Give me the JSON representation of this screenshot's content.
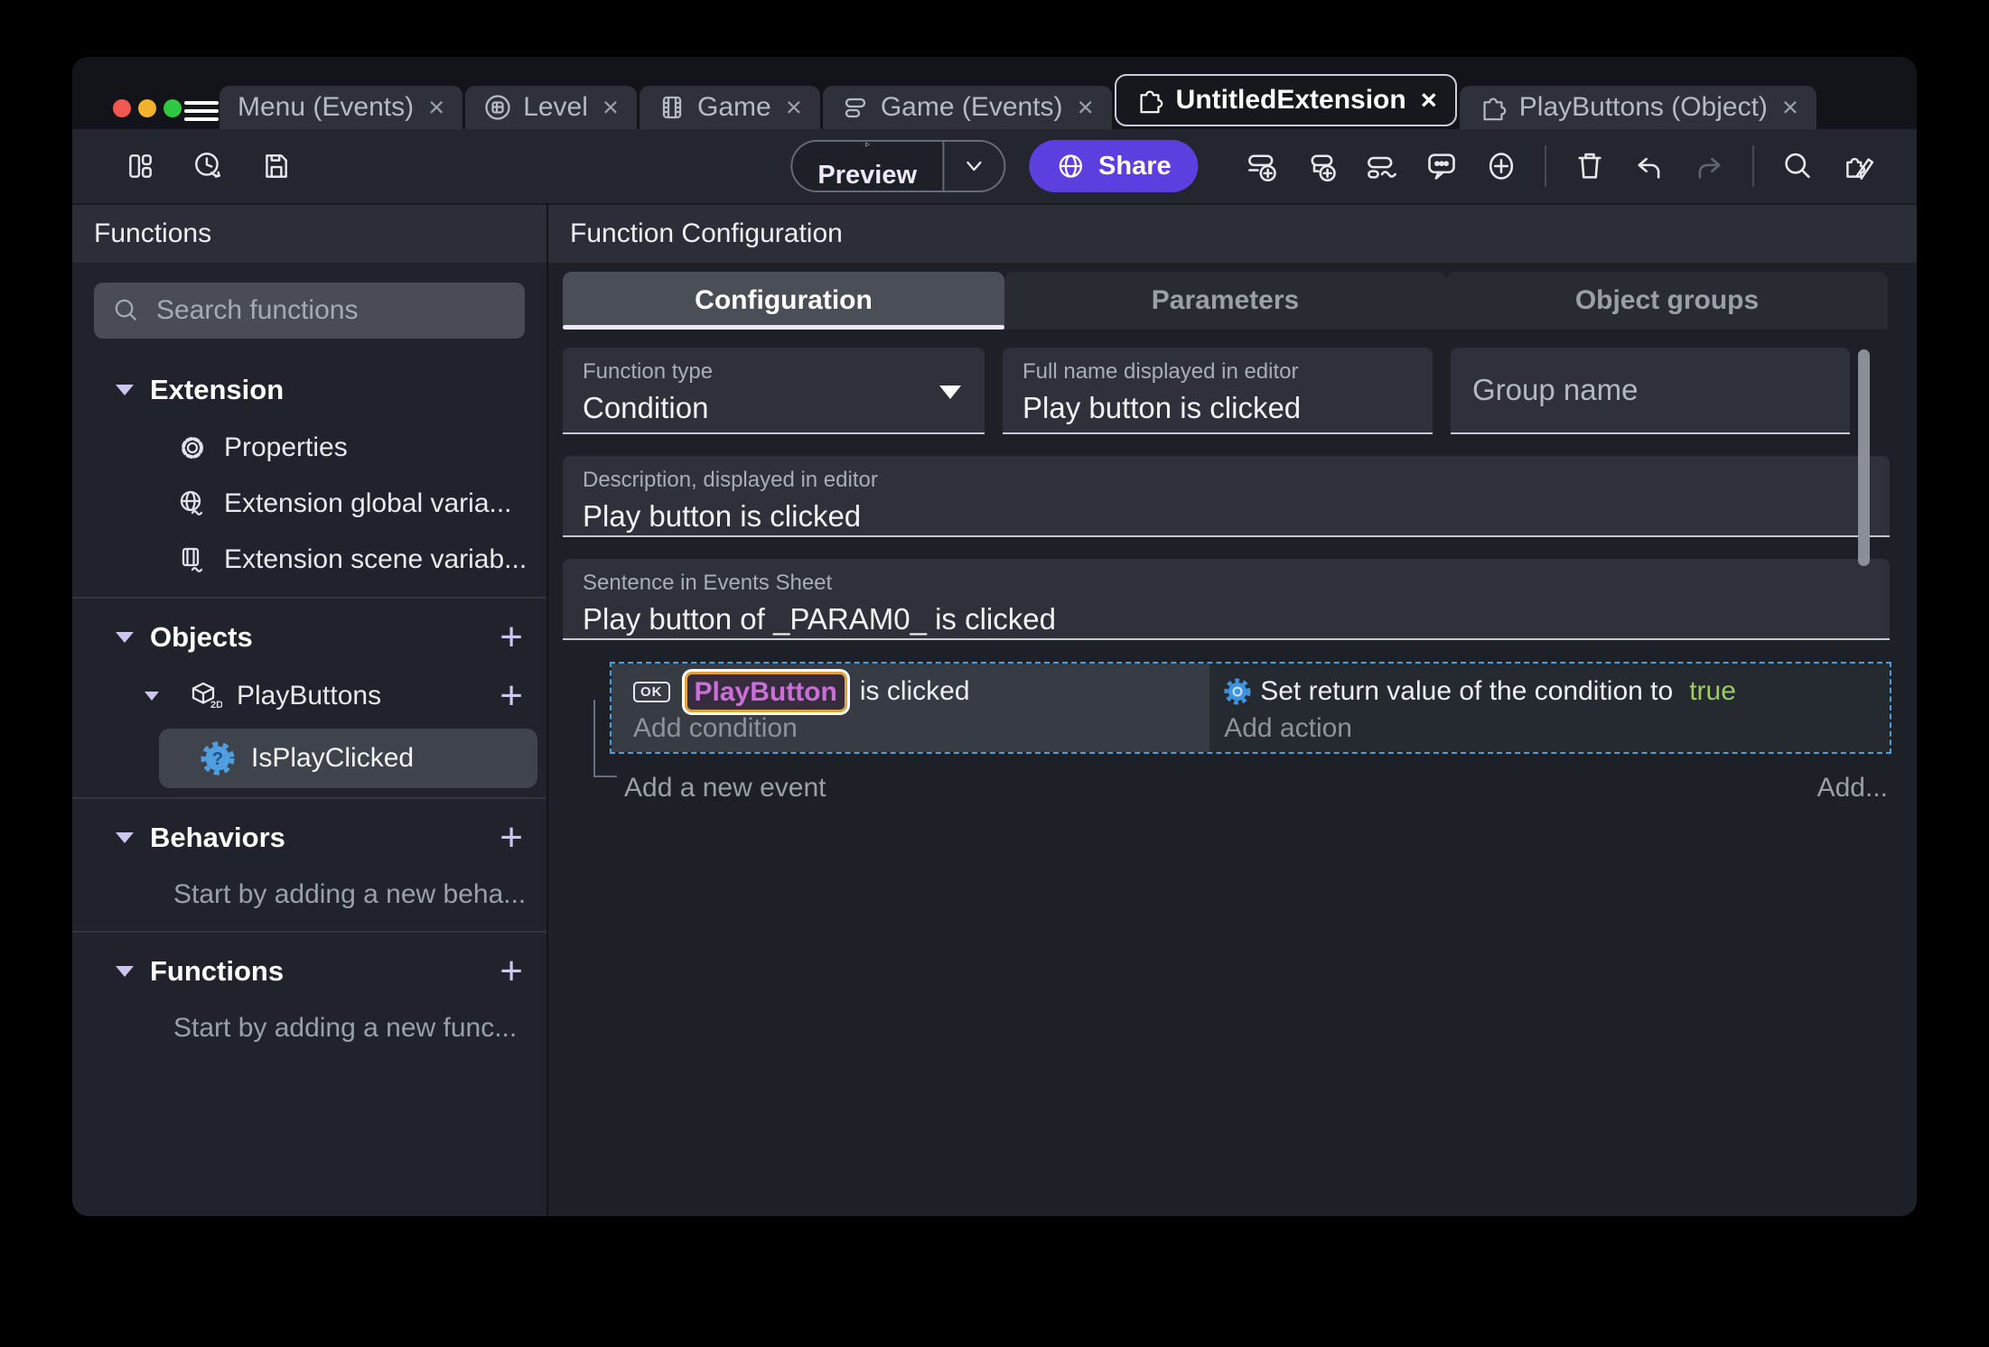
{
  "tabs": [
    {
      "label": "Menu (Events)"
    },
    {
      "label": "Level"
    },
    {
      "label": "Game"
    },
    {
      "label": "Game (Events)"
    },
    {
      "label": "UntitledExtension"
    },
    {
      "label": "PlayButtons (Object)"
    }
  ],
  "tab_close_glyph": "×",
  "toolbar": {
    "preview_label": "Preview",
    "share_label": "Share"
  },
  "sidebar": {
    "title": "Functions",
    "search_placeholder": "Search functions",
    "plus_glyph": "+",
    "extension_label": "Extension",
    "properties_label": "Properties",
    "global_vars_label": "Extension global varia...",
    "scene_vars_label": "Extension scene variab...",
    "objects_label": "Objects",
    "playbuttons_label": "PlayButtons",
    "isplayclicked_label": "IsPlayClicked",
    "behaviors_label": "Behaviors",
    "behaviors_hint": "Start by adding a new beha...",
    "functions_label": "Functions",
    "functions_hint": "Start by adding a new func..."
  },
  "main": {
    "title": "Function Configuration",
    "tab_configuration": "Configuration",
    "tab_parameters": "Parameters",
    "tab_object_groups": "Object groups",
    "function_type_label": "Function type",
    "function_type_value": "Condition",
    "full_name_label": "Full name displayed in editor",
    "full_name_value": "Play button is clicked",
    "group_name_placeholder": "Group name",
    "description_label": "Description, displayed in editor",
    "description_value": "Play button is clicked",
    "sentence_label": "Sentence in Events Sheet",
    "sentence_value": "Play button of _PARAM0_ is clicked"
  },
  "events": {
    "ok_badge": "OK",
    "condition_object": "PlayButton",
    "condition_text": "is clicked",
    "add_condition": "Add condition",
    "action_text": "Set return value of the condition to",
    "action_value": "true",
    "add_action": "Add action",
    "add_event": "Add a new event",
    "add_more": "Add..."
  },
  "colors": {
    "share_button": "#5d3fe0",
    "accent_lavender": "#cdc4f0",
    "selection_blue": "#4aa0dc",
    "object_chip_text": "#cb6fd6",
    "object_chip_border": "#e2a23c",
    "true_green": "#9ccc65"
  }
}
